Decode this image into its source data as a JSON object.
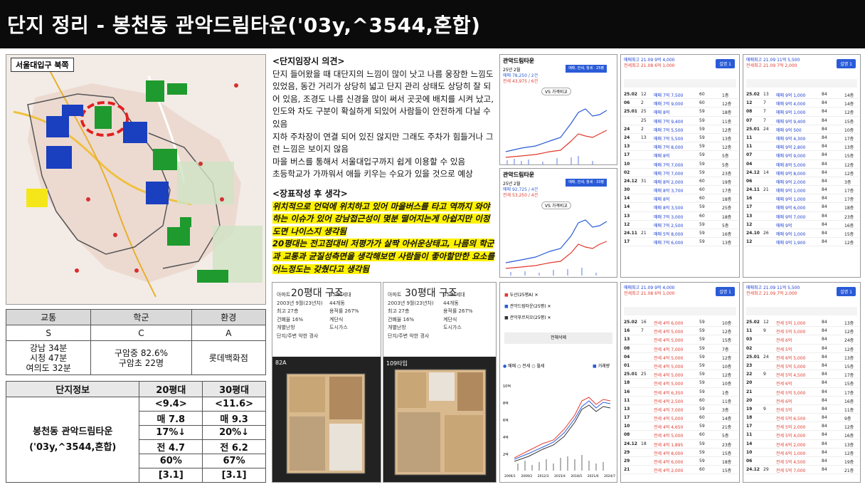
{
  "title": "단지 정리 - 봉천동 관악드림타운('03y,^3544,혼합)",
  "map": {
    "label": "서울대입구 북쪽"
  },
  "score_table": {
    "headers": [
      "교통",
      "학군",
      "환경"
    ],
    "grades": [
      "S",
      "C",
      "A"
    ],
    "transport_desc": [
      "강남 34분",
      "시청 47분",
      "여의도 32분"
    ],
    "school_desc": [
      "구암중 82.6%",
      "구암초 22명"
    ],
    "env_desc": "롯데백화점"
  },
  "info_table": {
    "headers": [
      "단지정보",
      "20평대",
      "30평대"
    ],
    "name_lines": [
      "봉천동 관악드림타운",
      "('03y,^3544,혼합)"
    ],
    "col20": [
      "<9.4>",
      "매 7.8",
      "17%↓",
      "전 4.7",
      "60%",
      "[3.1]"
    ],
    "col30": [
      "<11.6>",
      "매 9.3",
      "20%↓",
      "전 6.2",
      "67%",
      "[3.1]"
    ]
  },
  "opinion_visit": {
    "heading": "<단지임장시 의견>",
    "lines": [
      "단지 들어왔을 때 대단지의 느낌이 많이 낫고 나름 웅장한 느낌도 있었음, 동간 거리가 상당히 넓고 단지 관리 상태도 상당히 잘 되어 있음, 조경도 나름 신경을 많이 써서 곳곳에 배치를 시켜 났고, 인도와 차도 구분이 확실하게 되있어 사람들이 안전하게 다닐 수 있음",
      "지하 주차장이 연결 되어 있진 않지만 그래도 주차가 힘들거나 그런 느낌은 보이지 않음",
      "마을 버스를 통해서 서울대입구까지 쉽게 이용할 수 있음",
      "초등학교가 가까워서 애들 키우는 수요가 있을 것으로 예상"
    ]
  },
  "opinion_after": {
    "heading": "<장표작성 후 생각>",
    "lines": [
      "위치적으로 언덕에 위치하고 있어 마을버스를 타고 역까지 와야하는 이슈가 있어 강남접근성이 몇분 떨어지는게 아쉽지만 이정도면 나이스지 생각됨",
      "20평대는 전고점대비 저평가가 살짝 아쉬운상태고, 나름의 학군과 교통과 균질성측면을 생각해보면 사람들이 좋아할만한 요소를 어느정도는 갖췄다고 생각됨"
    ]
  },
  "chart1": {
    "title": "관악드림타운",
    "date": "25년 2월",
    "sale": "매매 78,250 / 2건",
    "rent": "전세 43,975 / 6건",
    "tag": "매매, 전세, 월세 · 25평",
    "compare": "VS 가격비교"
  },
  "chart2": {
    "title": "관악드림타운",
    "date": "25년 2월",
    "sale": "매매 92,725 / 4건",
    "rent": "전세 53,250 / 4건",
    "tag": "매매, 전세, 월세 · 33평",
    "compare": "VS 가격비교"
  },
  "floorplans": {
    "title20": "20평대 구조",
    "title30": "30평대 구조",
    "list20": [
      "아파트",
      "2003년 9월(23년차)",
      "최고 27층",
      "건폐율 16%",
      "개별난방",
      "단지/주변 악한 경사"
    ],
    "list20b": [
      "3544세대",
      "44개동",
      "용적률 267%",
      "계단식",
      "도시가스"
    ],
    "list30": [
      "아파트",
      "2003년 9월(23년차)",
      "최고 27층",
      "건폐율 16%",
      "개별난방",
      "단지/주변 악한 경사"
    ],
    "list30b": [
      "3544세대",
      "44개동",
      "용적률 267%",
      "계단식",
      "도시가스"
    ],
    "type20": "82A",
    "type30": "109타입"
  },
  "compare_chart": {
    "items": [
      "두산(25평A)",
      "관악드림타운(25평)",
      "관악푸르지오(25평)"
    ],
    "button": "전체삭제",
    "legend": [
      "매매",
      "전세",
      "월세"
    ],
    "volume": "거래량",
    "yticks": [
      "10억",
      "8억",
      "6억",
      "4억",
      "2억"
    ],
    "xticks": [
      "2006/1",
      "2009/2",
      "2012/3",
      "2015/4",
      "2018/5",
      "2021/6",
      "2024/7"
    ]
  },
  "tx_panels": [
    {
      "hi1": "매매최고 21.09 9억 4,000",
      "hi2": "전세최고 21.08 6억 1,000",
      "btn": "설명 1",
      "rows": [
        [
          "25.02",
          "12",
          "매매 7억 7,500",
          "60",
          "1층"
        ],
        [
          "06",
          "2",
          "매매 7억 9,000",
          "60",
          "12층"
        ],
        [
          "25.01",
          "25",
          "매매 8억",
          "59",
          "18층"
        ],
        [
          "",
          "25",
          "매매 7억 9,400",
          "59",
          "11층"
        ],
        [
          "24",
          "2",
          "매매 7억 5,500",
          "59",
          "12층"
        ],
        [
          "24",
          "13",
          "매매 7억 5,500",
          "59",
          "13층"
        ],
        [
          "13",
          "",
          "매매 7억 8,000",
          "59",
          "12층"
        ],
        [
          "17",
          "",
          "매매 8억",
          "59",
          "5층"
        ],
        [
          "10",
          "",
          "매매 7억 7,000",
          "59",
          "5층"
        ],
        [
          "02",
          "",
          "매매 7억 7,000",
          "59",
          "23층"
        ],
        [
          "24.12",
          "31",
          "매매 8억 2,000",
          "60",
          "19층"
        ],
        [
          "30",
          "",
          "매매 8억 3,700",
          "60",
          "17층"
        ],
        [
          "14",
          "",
          "매매 8억",
          "60",
          "18층"
        ],
        [
          "14",
          "",
          "매매 8억 3,500",
          "59",
          "25층"
        ],
        [
          "13",
          "",
          "매매 7억 3,000",
          "60",
          "18층"
        ],
        [
          "12",
          "",
          "매매 7억 2,500",
          "59",
          "5층"
        ],
        [
          "24.11",
          "21",
          "매매 5억 8,000",
          "59",
          "16층"
        ],
        [
          "17",
          "",
          "매매 7억 6,000",
          "59",
          "13층"
        ]
      ]
    },
    {
      "hi1": "매매최고 21.09 11억 5,500",
      "hi2": "전세최고 21.09 7억 2,000",
      "btn": "설명 1",
      "rows": [
        [
          "25.02",
          "13",
          "매매 9억 1,000",
          "84",
          "14층"
        ],
        [
          "12",
          "7",
          "매매 9억 4,000",
          "84",
          "14층"
        ],
        [
          "08",
          "7",
          "매매 9억 1,000",
          "84",
          "12층"
        ],
        [
          "07",
          "7",
          "매매 9억 9,400",
          "84",
          "15층"
        ],
        [
          "25.01",
          "24",
          "매매 9억 500",
          "84",
          "10층"
        ],
        [
          "11",
          "",
          "매매 9억 4,300",
          "84",
          "17층"
        ],
        [
          "11",
          "",
          "매매 9억 2,800",
          "84",
          "13층"
        ],
        [
          "07",
          "",
          "매매 9억 9,000",
          "84",
          "15층"
        ],
        [
          "04",
          "",
          "매매 8억 5,000",
          "84",
          "12층"
        ],
        [
          "24.12",
          "14",
          "매매 9억 8,000",
          "84",
          "12층"
        ],
        [
          "06",
          "",
          "매매 9억 2,000",
          "84",
          "3층"
        ],
        [
          "24.11",
          "21",
          "매매 9억 1,000",
          "84",
          "17층"
        ],
        [
          "16",
          "",
          "매매 9억 1,000",
          "84",
          "17층"
        ],
        [
          "17",
          "",
          "매매 9억 6,000",
          "84",
          "18층"
        ],
        [
          "13",
          "",
          "매매 9억 7,000",
          "84",
          "23층"
        ],
        [
          "12",
          "",
          "매매 9억",
          "84",
          "16층"
        ],
        [
          "24.10",
          "26",
          "매매 9억 1,000",
          "84",
          "15층"
        ],
        [
          "12",
          "",
          "매매 9억 1,900",
          "84",
          "12층"
        ]
      ]
    },
    {
      "hi1": "매매최고 21.09 9억 4,000",
      "hi2": "전세최고 21.08 6억 1,000",
      "btn": "설명 1",
      "rows": [
        [
          "25.02",
          "16",
          "전세 4억 6,000",
          "59",
          "10층"
        ],
        [
          "16",
          "7",
          "전세 4억 5,000",
          "59",
          "12층"
        ],
        [
          "13",
          "",
          "전세 4억 5,000",
          "59",
          "15층"
        ],
        [
          "08",
          "",
          "전세 4억 7,000",
          "59",
          "7층"
        ],
        [
          "04",
          "",
          "전세 4억 5,000",
          "59",
          "12층"
        ],
        [
          "01",
          "",
          "전세 4억 5,000",
          "59",
          "10층"
        ],
        [
          "25.01",
          "25",
          "전세 4억 5,000",
          "59",
          "12층"
        ],
        [
          "18",
          "",
          "전세 4억 5,000",
          "59",
          "10층"
        ],
        [
          "16",
          "",
          "전세 4억 6,350",
          "59",
          "1층"
        ],
        [
          "11",
          "",
          "전세 4억 2,500",
          "60",
          "11층"
        ],
        [
          "13",
          "",
          "전세 4억 7,000",
          "59",
          "3층"
        ],
        [
          "17",
          "",
          "전세 4억 5,000",
          "60",
          "14층"
        ],
        [
          "10",
          "",
          "전세 4억 4,650",
          "59",
          "21층"
        ],
        [
          "08",
          "",
          "전세 4억 5,000",
          "60",
          "5층"
        ],
        [
          "24.12",
          "18",
          "전세 4억 1,895",
          "59",
          "23층"
        ],
        [
          "29",
          "",
          "전세 4억 8,000",
          "59",
          "15층"
        ],
        [
          "29",
          "",
          "전세 4억 6,000",
          "59",
          "18층"
        ],
        [
          "21",
          "",
          "전세 4억 2,000",
          "60",
          "15층"
        ]
      ]
    },
    {
      "hi1": "매매최고 21.09 11억 5,500",
      "hi2": "전세최고 21.09 7억 2,000",
      "btn": "설명 1",
      "rows": [
        [
          "25.02",
          "12",
          "전세 5억 1,000",
          "84",
          "13층"
        ],
        [
          "11",
          "9",
          "전세 5억 5,000",
          "84",
          "12층"
        ],
        [
          "03",
          "",
          "전세 6억",
          "84",
          "24층"
        ],
        [
          "02",
          "",
          "전세 5억",
          "84",
          "12층"
        ],
        [
          "25.01",
          "24",
          "전세 6억 5,000",
          "84",
          "13층"
        ],
        [
          "23",
          "",
          "전세 5억 5,000",
          "84",
          "15층"
        ],
        [
          "22",
          "9",
          "전세 5억 4,500",
          "84",
          "17층"
        ],
        [
          "20",
          "",
          "전세 6억",
          "84",
          "15층"
        ],
        [
          "21",
          "",
          "전세 5억 5,000",
          "84",
          "17층"
        ],
        [
          "20",
          "",
          "전세 6억",
          "84",
          "16층"
        ],
        [
          "19",
          "9",
          "전세 5억",
          "84",
          "11층"
        ],
        [
          "18",
          "",
          "전세 5억 6,500",
          "84",
          "9층"
        ],
        [
          "17",
          "",
          "전세 5억 2,000",
          "84",
          "12층"
        ],
        [
          "11",
          "",
          "전세 5억 4,000",
          "84",
          "16층"
        ],
        [
          "14",
          "",
          "전세 6억 2,000",
          "84",
          "13층"
        ],
        [
          "10",
          "",
          "전세 6억 1,000",
          "84",
          "12층"
        ],
        [
          "06",
          "",
          "전세 5억 4,500",
          "84",
          "19층"
        ],
        [
          "24.12",
          "29",
          "전세 5억 7,000",
          "84",
          "21층"
        ]
      ]
    }
  ]
}
